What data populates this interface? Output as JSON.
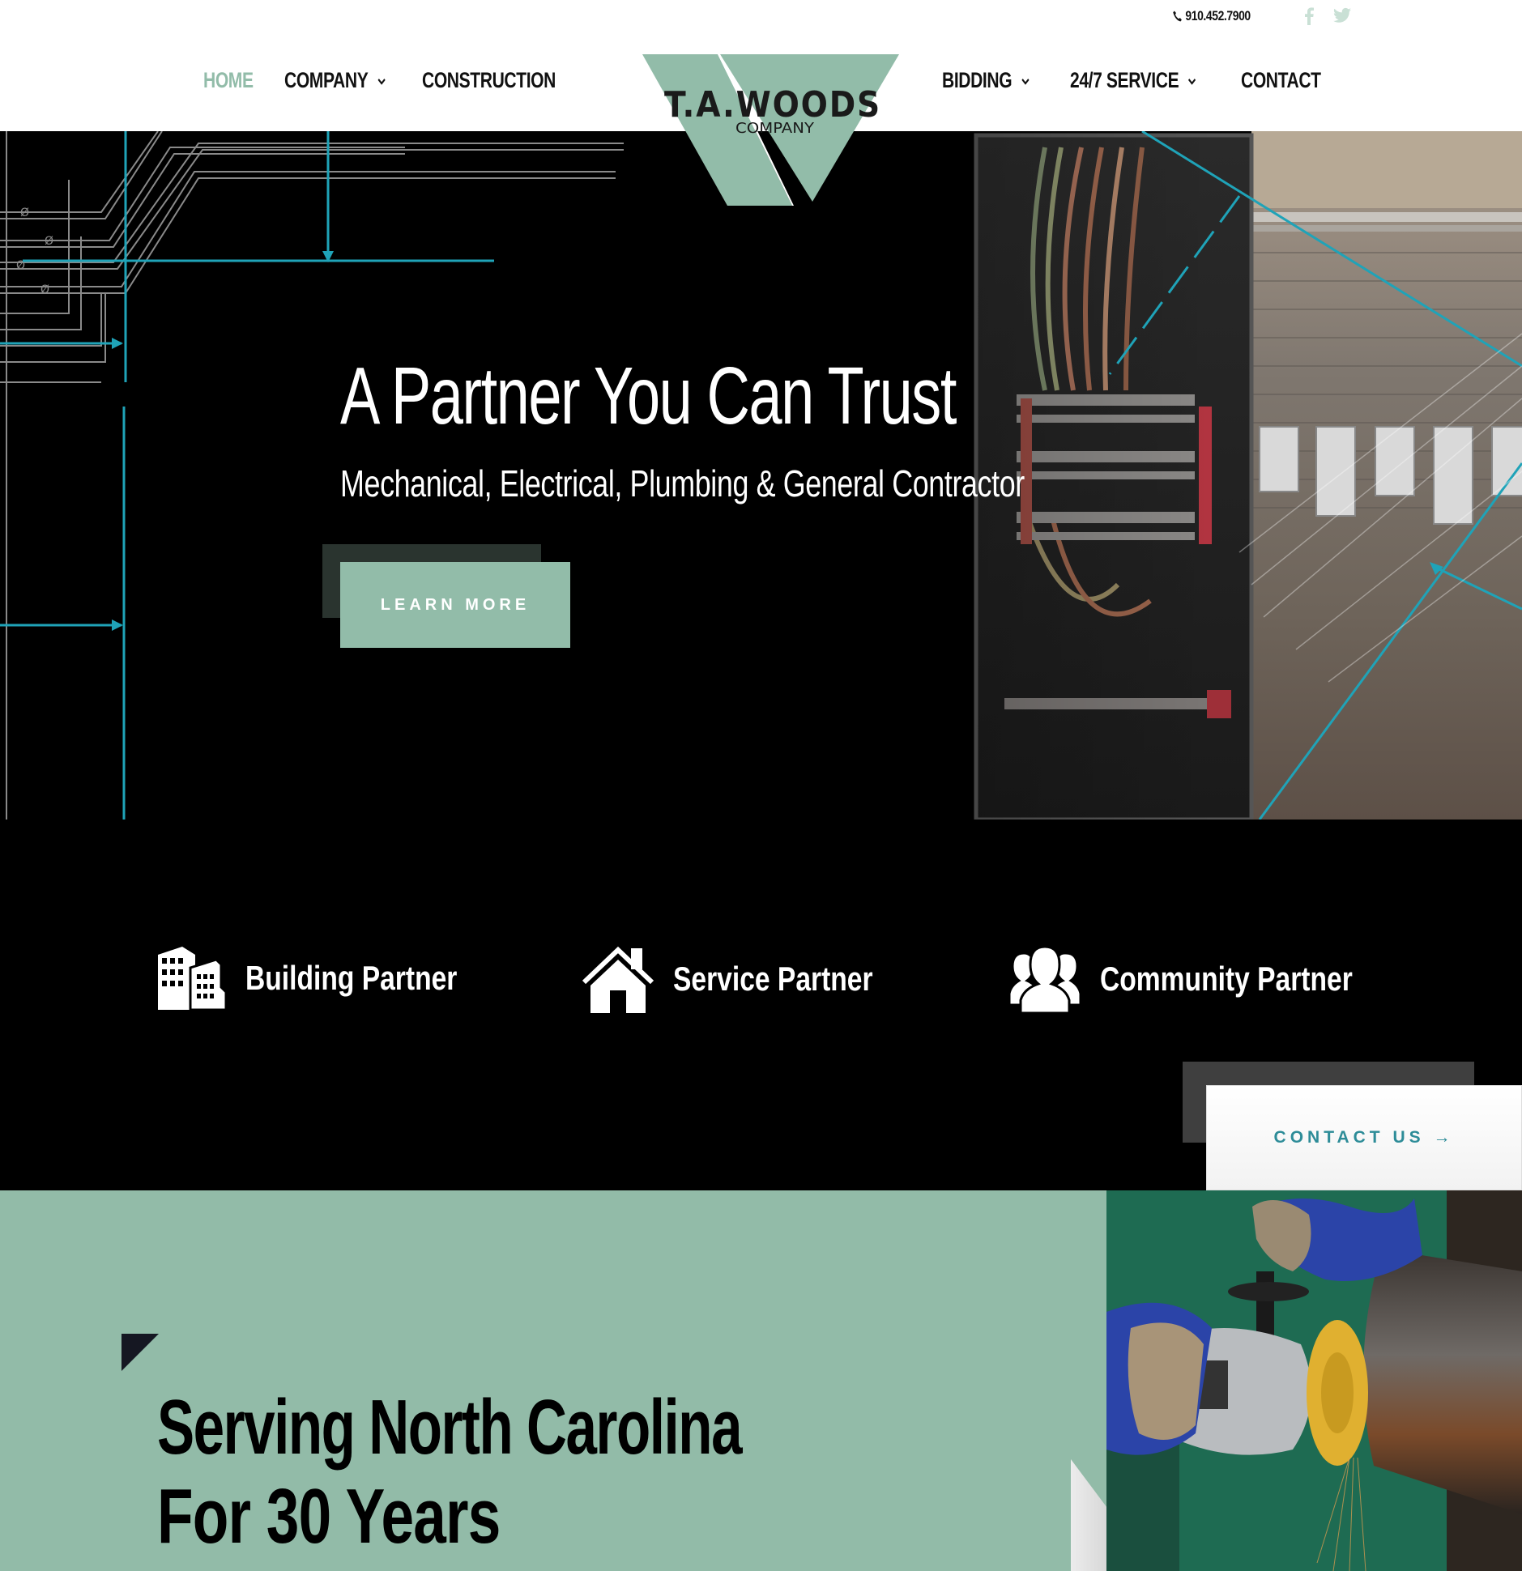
{
  "header": {
    "phone": "910.452.7900",
    "social": [
      {
        "name": "facebook",
        "icon": "facebook-icon"
      },
      {
        "name": "twitter",
        "icon": "twitter-icon"
      }
    ],
    "nav_left": [
      {
        "label": "HOME",
        "active": true,
        "has_dropdown": false
      },
      {
        "label": "COMPANY",
        "active": false,
        "has_dropdown": true
      },
      {
        "label": "CONSTRUCTION",
        "active": false,
        "has_dropdown": true
      }
    ],
    "nav_right": [
      {
        "label": "BIDDING",
        "active": false,
        "has_dropdown": true
      },
      {
        "label": "24/7 SERVICE",
        "active": false,
        "has_dropdown": true
      },
      {
        "label": "CONTACT",
        "active": false,
        "has_dropdown": false
      }
    ],
    "logo": {
      "name": "T.A.WOODS",
      "sub": "COMPANY"
    }
  },
  "hero": {
    "title": "A Partner You Can Trust",
    "subtitle": "Mechanical, Electrical, Plumbing & General Contractor",
    "cta": "LEARN MORE"
  },
  "partners": {
    "items": [
      {
        "label": "Building Partner",
        "icon": "buildings-icon"
      },
      {
        "label": "Service Partner",
        "icon": "house-icon"
      },
      {
        "label": "Community Partner",
        "icon": "people-group-icon"
      }
    ],
    "contact_cta": "CONTACT US →"
  },
  "about": {
    "line1": "Serving North Carolina",
    "line2": "For 30 Years"
  },
  "colors": {
    "brand_green": "#92bca9",
    "accent_teal": "#2d8c98",
    "blueprint_line": "#1fa3b8",
    "dark": "#000000"
  }
}
